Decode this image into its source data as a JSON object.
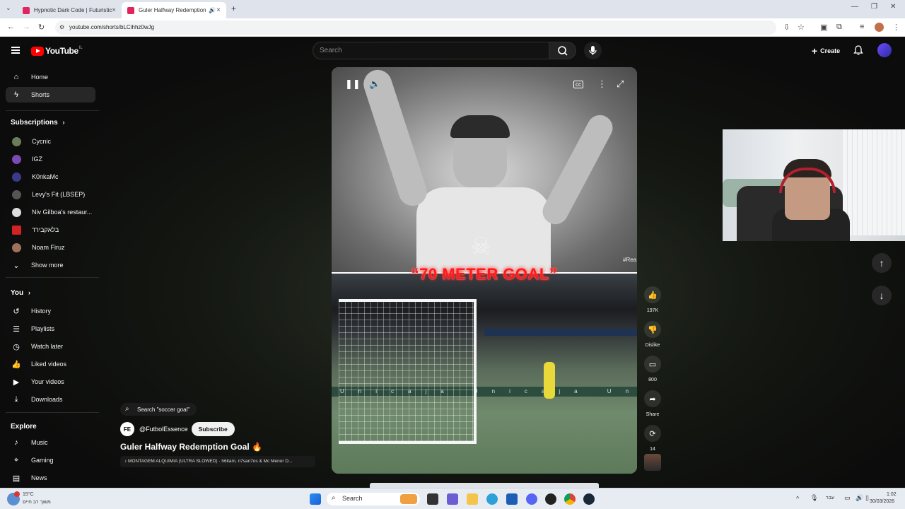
{
  "browser": {
    "tabs": [
      {
        "title": "Hypnotic Dark Code | Futuristic"
      },
      {
        "title": "Guler Halfway Redemption"
      }
    ],
    "url": "youtube.com/shorts/bLCihhz0wJg"
  },
  "header": {
    "logo_text": "YouTube",
    "country": "IL",
    "search_placeholder": "Search",
    "create_label": "Create"
  },
  "sidebar": {
    "main": [
      {
        "label": "Home",
        "icon": "home-icon"
      },
      {
        "label": "Shorts",
        "icon": "shorts-icon",
        "active": true
      }
    ],
    "subscriptions_title": "Subscriptions",
    "subscriptions": [
      {
        "label": "Cycnic",
        "color": "#6b7c5a"
      },
      {
        "label": "IGZ",
        "color": "#7a4bb5"
      },
      {
        "label": "K0nkaMc",
        "color": "#3a3a8a"
      },
      {
        "label": "Levy's Fit (LBSEP)",
        "color": "#555555"
      },
      {
        "label": "Niv Gilboa's restaur...",
        "color": "#dddddd"
      },
      {
        "label": "בלאקבירד",
        "color": "#d22222"
      },
      {
        "label": "Noam Firuz",
        "color": "#a0715a"
      }
    ],
    "show_more": "Show more",
    "you_title": "You",
    "you": [
      {
        "label": "History",
        "icon": "history-icon"
      },
      {
        "label": "Playlists",
        "icon": "playlists-icon"
      },
      {
        "label": "Watch later",
        "icon": "watch-later-icon"
      },
      {
        "label": "Liked videos",
        "icon": "liked-icon"
      },
      {
        "label": "Your videos",
        "icon": "your-videos-icon"
      },
      {
        "label": "Downloads",
        "icon": "downloads-icon"
      }
    ],
    "explore_title": "Explore",
    "explore": [
      {
        "label": "Music",
        "icon": "music-icon"
      },
      {
        "label": "Gaming",
        "icon": "gaming-icon"
      },
      {
        "label": "News",
        "icon": "news-icon"
      }
    ]
  },
  "video": {
    "caption": "“70 METER GOAL”",
    "watermark": "#Rea",
    "ad_text": "Unicaja Unicaja Unicaja Unicaja Unicaja"
  },
  "actions": {
    "likes": "197K",
    "dislike": "Dislike",
    "comments": "800",
    "share": "Share",
    "remix": "14"
  },
  "meta": {
    "search_pill": "Search \"soccer goal\"",
    "channel_avatar": "FE",
    "channel": "@FutbolEssence",
    "subscribe": "Subscribe",
    "title": "Guler Halfway Redemption Goal 🔥",
    "music": "♪ MONTAGEM ALQUIMIA (ULTRA SLOWED) · h6itam, n7san7os & Mc Menor D..."
  },
  "taskbar": {
    "weather_temp": "15°C",
    "weather_desc": "משוך רב חיים",
    "search": "Search",
    "lang": "עבר",
    "time": "1:02",
    "date": "30/03/2026"
  }
}
